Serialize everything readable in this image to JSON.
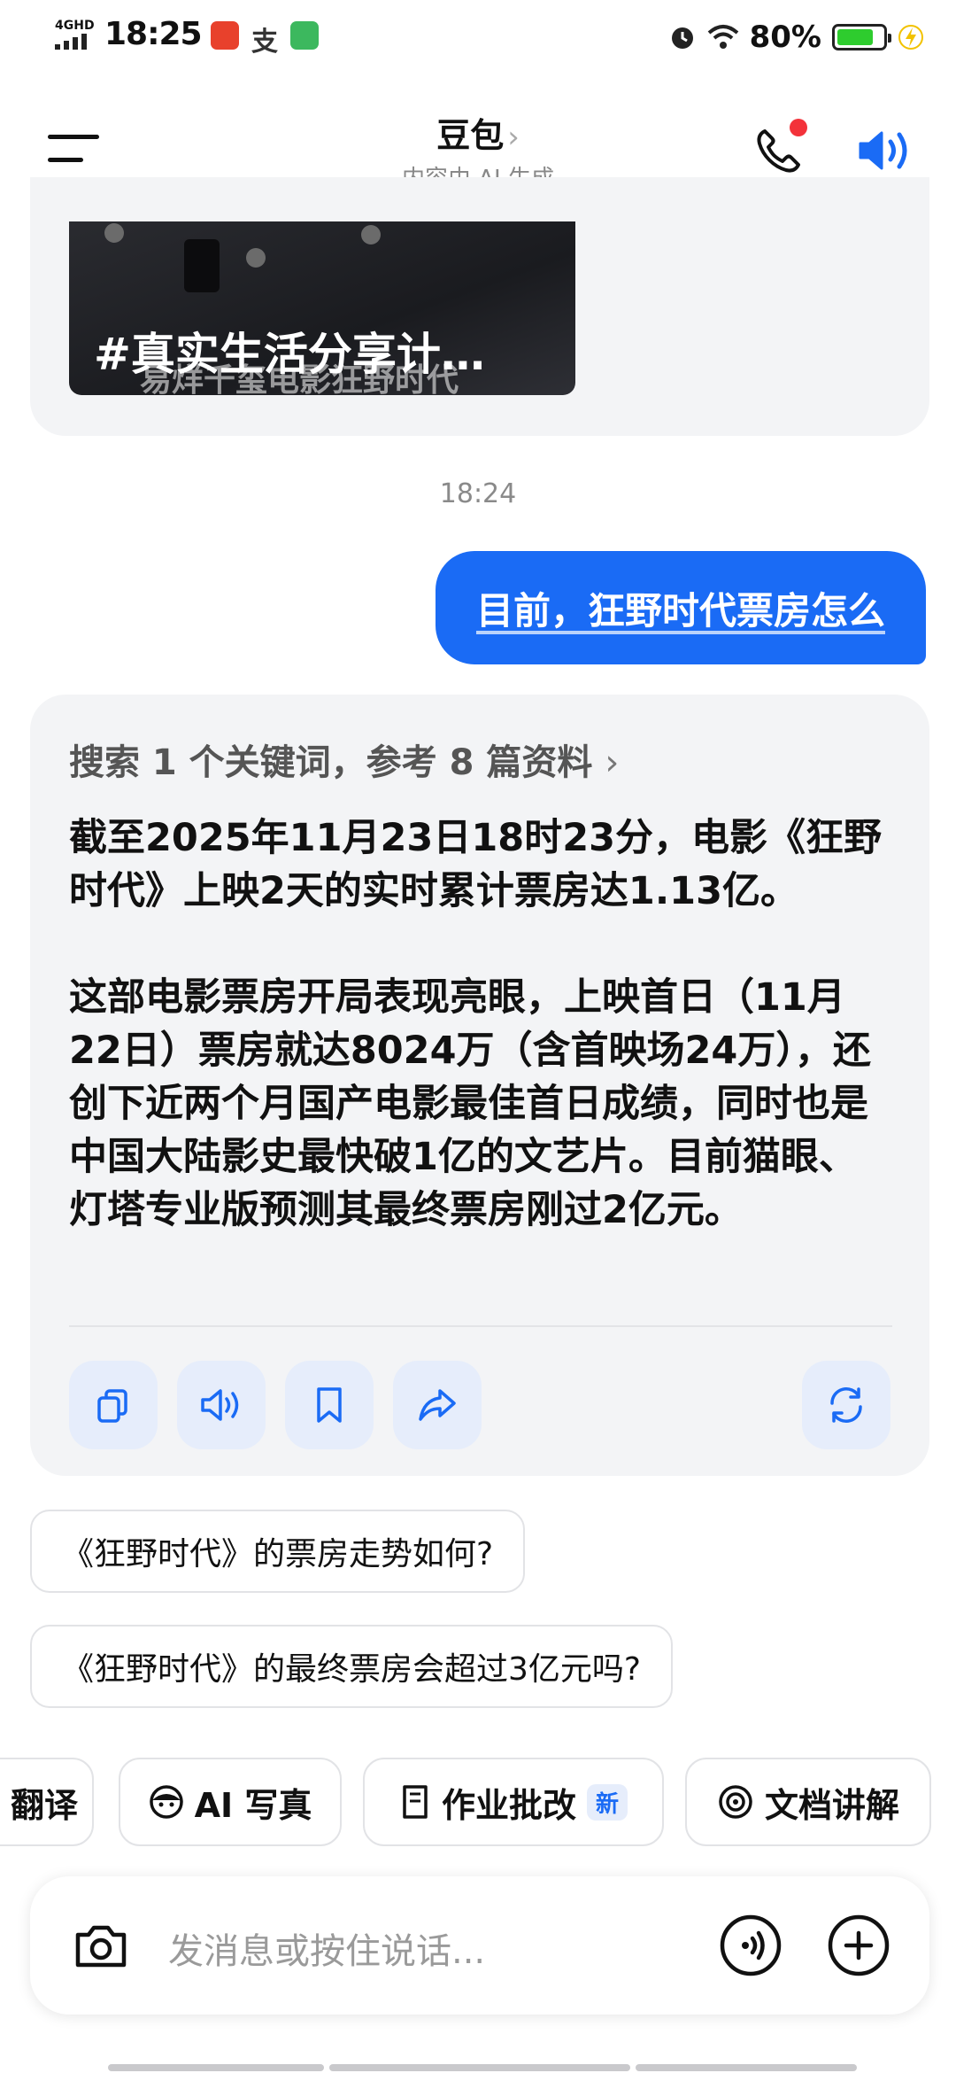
{
  "status": {
    "network": "4GHD",
    "time": "18:25",
    "battery_percent": "80%",
    "battery_level": 0.8
  },
  "header": {
    "title": "豆包",
    "chevron": "›",
    "subtitle": "内容由 AI 生成"
  },
  "prev_message": {
    "video_title": "#真实生活分享计…",
    "video_caption": "易烊千玺电影狂野时代"
  },
  "timestamp": "18:24",
  "user_message": "目前，狂野时代票房怎么",
  "answer": {
    "search_summary": "搜索 1 个关键词，参考 8 篇资料",
    "search_chevron": "›",
    "paragraph1": "截至2025年11月23日18时23分，电影《狂野时代》上映2天的实时累计票房达1.13亿。",
    "paragraph2": "这部电影票房开局表现亮眼，上映首日（11月22日）票房就达8024万（含首映场24万），还创下近两个月国产电影最佳首日成绩，同时也是中国大陆影史最快破1亿的文艺片。目前猫眼、灯塔专业版预测其最终票房刚过2亿元。"
  },
  "suggestions": [
    "《狂野时代》的票房走势如何?",
    "《狂野时代》的最终票房会超过3亿元吗?"
  ],
  "tools": {
    "translate": "翻译",
    "ai_photo": "AI 写真",
    "homework": "作业批改",
    "homework_badge": "新",
    "doc_explain": "文档讲解"
  },
  "input": {
    "placeholder": "发消息或按住说话..."
  },
  "colors": {
    "accent": "#1a6bf5",
    "card_bg": "#f3f4f6",
    "notification_dot": "#f3323a",
    "battery": "#2ecc2e"
  }
}
